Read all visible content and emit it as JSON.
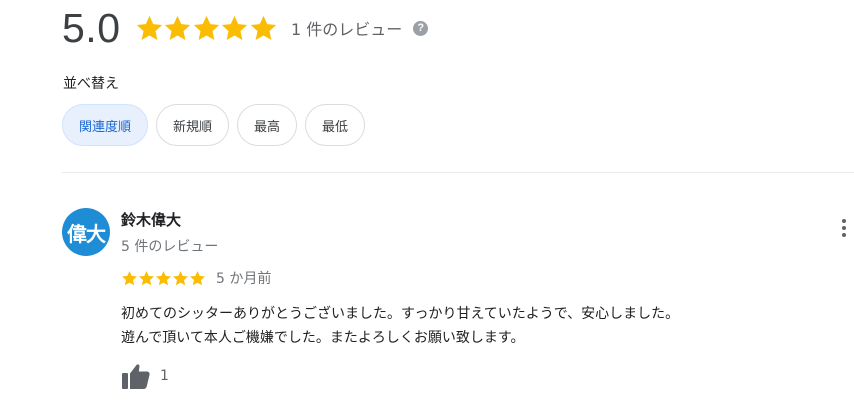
{
  "summary": {
    "rating": "5.0",
    "stars": 5,
    "star_color": "#fbbc04",
    "review_count": "1 件のレビュー",
    "help_icon": "?"
  },
  "sort": {
    "label": "並べ替え",
    "options": [
      "関連度順",
      "新規順",
      "最高",
      "最低"
    ],
    "selected": "関連度順"
  },
  "review": {
    "avatar_text": "偉大",
    "avatar_color": "#1f8dd6",
    "author": "鈴木偉大",
    "author_reviews": "5 件のレビュー",
    "stars": 5,
    "date": "5 か月前",
    "text": "初めてのシッターありがとうございました。すっかり甘えていたようで、安心しました。\n遊んで頂いて本人ご機嫌でした。またよろしくお願い致します。",
    "likes": "1"
  },
  "icons": {
    "help": "help-circle-icon",
    "more": "more-vert-icon",
    "like": "thumb-up-icon",
    "star": "star-icon"
  }
}
